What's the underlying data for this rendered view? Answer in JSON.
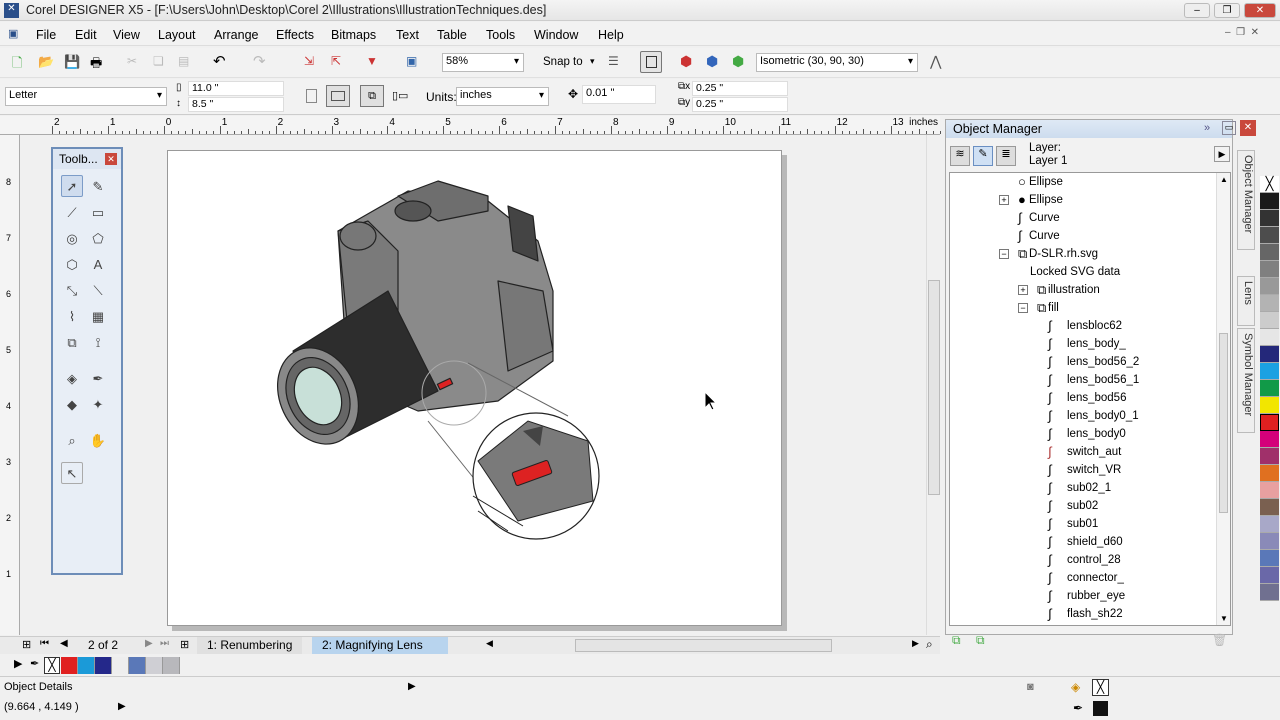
{
  "window": {
    "title": "Corel DESIGNER X5 - [F:\\Users\\John\\Desktop\\Corel 2\\Illustrations\\IllustrationTechniques.des]"
  },
  "menu": [
    "File",
    "Edit",
    "View",
    "Layout",
    "Arrange",
    "Effects",
    "Bitmaps",
    "Text",
    "Table",
    "Tools",
    "Window",
    "Help"
  ],
  "toolbar": {
    "zoom": "58%",
    "snap_to": "Snap to",
    "projection": "Isometric (30, 90, 30)"
  },
  "property_bar": {
    "paper": "Letter",
    "width": "11.0 \"",
    "height": "8.5 \"",
    "units_label": "Units:",
    "units": "inches",
    "nudge": "0.01 \"",
    "dup_x": "0.25 \"",
    "dup_y": "0.25 \""
  },
  "ruler": {
    "ticks": [
      "2",
      "1",
      "0",
      "1",
      "2",
      "3",
      "4",
      "5",
      "6",
      "7",
      "8",
      "9",
      "10",
      "11",
      "12",
      "13"
    ],
    "unit": "inches",
    "vticks": [
      "8",
      "7",
      "6",
      "5",
      "4",
      "3",
      "2",
      "1"
    ]
  },
  "toolbox": {
    "title": "Toolb..."
  },
  "object_manager": {
    "title": "Object Manager",
    "layer_label": "Layer:",
    "layer_name": "Layer 1",
    "items": [
      {
        "label": "Ellipse",
        "level": 1,
        "icon": "ellipse-outline"
      },
      {
        "label": "Ellipse",
        "level": 1,
        "icon": "ellipse-filled",
        "expand": "+"
      },
      {
        "label": "Curve",
        "level": 1,
        "icon": "curve"
      },
      {
        "label": "Curve",
        "level": 1,
        "icon": "curve"
      },
      {
        "label": "D-SLR.rh.svg",
        "level": 1,
        "icon": "group",
        "expand": "-"
      },
      {
        "label": "Locked SVG data",
        "level": 2,
        "icon": "none"
      },
      {
        "label": "illustration",
        "level": 2,
        "icon": "group",
        "expand": "+"
      },
      {
        "label": "fill",
        "level": 2,
        "icon": "group",
        "expand": "-"
      },
      {
        "label": "lensbloc62",
        "level": 3,
        "icon": "curve"
      },
      {
        "label": "lens_body_",
        "level": 3,
        "icon": "curve"
      },
      {
        "label": "lens_bod56_2",
        "level": 3,
        "icon": "curve"
      },
      {
        "label": "lens_bod56_1",
        "level": 3,
        "icon": "curve"
      },
      {
        "label": "lens_bod56",
        "level": 3,
        "icon": "curve"
      },
      {
        "label": "lens_body0_1",
        "level": 3,
        "icon": "curve"
      },
      {
        "label": "lens_body0",
        "level": 3,
        "icon": "curve"
      },
      {
        "label": "switch_aut",
        "level": 3,
        "icon": "curve-red"
      },
      {
        "label": "switch_VR",
        "level": 3,
        "icon": "curve"
      },
      {
        "label": "sub02_1",
        "level": 3,
        "icon": "curve"
      },
      {
        "label": "sub02",
        "level": 3,
        "icon": "curve"
      },
      {
        "label": "sub01",
        "level": 3,
        "icon": "curve"
      },
      {
        "label": "shield_d60",
        "level": 3,
        "icon": "curve"
      },
      {
        "label": "control_28",
        "level": 3,
        "icon": "curve"
      },
      {
        "label": "connector_",
        "level": 3,
        "icon": "curve"
      },
      {
        "label": "rubber_eye",
        "level": 3,
        "icon": "curve"
      },
      {
        "label": "flash_sh22",
        "level": 3,
        "icon": "curve"
      }
    ]
  },
  "dock_tabs": [
    "Object Manager",
    "Lens",
    "Symbol Manager"
  ],
  "palette_colors": [
    "#1a1a1a",
    "#333333",
    "#4d4d4d",
    "#666666",
    "#808080",
    "#999999",
    "#b3b3b3",
    "#cccccc",
    "#e6e6e6",
    "#24287a",
    "#1ba1e2",
    "#119a48",
    "#f2e600",
    "#e02020",
    "#d4007a",
    "#a0306a",
    "#e07020",
    "#e8a0a0",
    "#7a6050",
    "#a8a8c8",
    "#8a8ab8",
    "#5a78b8",
    "#6a68a8",
    "#707090"
  ],
  "page_nav": {
    "counter": "2 of 2",
    "tabs": [
      "1: Renumbering",
      "2: Magnifying Lens"
    ],
    "active": 1
  },
  "document_palette": [
    "#e02020",
    "#1b9ad8",
    "#24288a",
    "#eeeeee",
    "#5a78b8",
    "#cfcfd4",
    "#b8b8bc"
  ],
  "status": {
    "object_details": "Object Details",
    "coordinates": "(9.664 , 4.149 )"
  }
}
